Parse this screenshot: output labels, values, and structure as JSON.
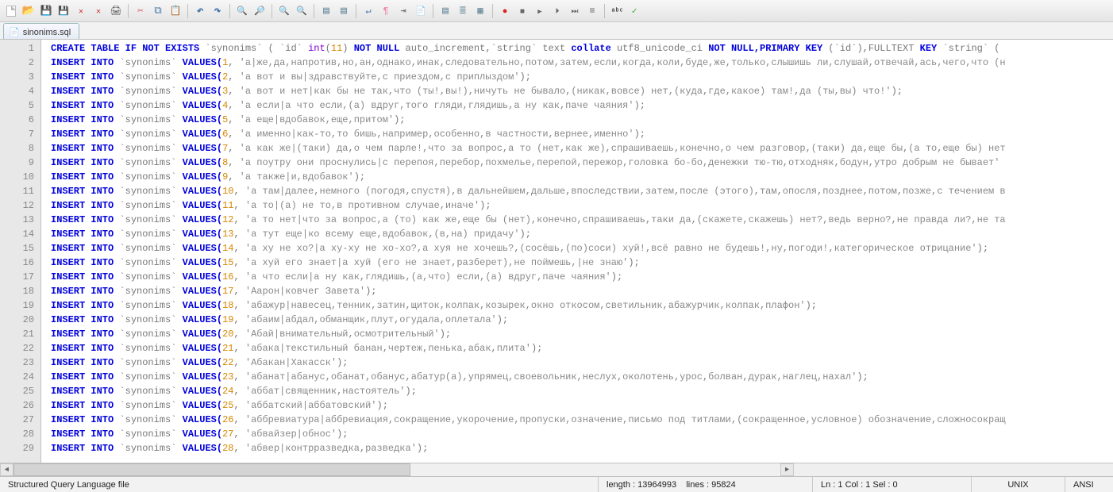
{
  "tab": {
    "name": "sinonims.sql"
  },
  "status": {
    "filetype": "Structured Query Language file",
    "length_label": "length : 13964993",
    "lines_label": "lines : 95824",
    "pos": "Ln : 1    Col : 1    Sel : 0",
    "eol": "UNIX",
    "encoding": "ANSI"
  },
  "editor": {
    "lines": [
      {
        "n": 1,
        "prefix": "CREATE TABLE IF NOT EXISTS",
        "t": " `synonims` ",
        "rest": "( `id` ",
        "type": "int",
        "paren": "(",
        "num": "11",
        "paren2": ")",
        "rest2": " NOT NULL auto_increment,`string` text ",
        "collate": "collate",
        "rest3": " utf8_unicode_ci ",
        "nn": "NOT NULL,PRIMARY KEY",
        "rest4": "  (`id`),FULLTEXT ",
        "key": "KEY",
        "rest5": " `string` ("
      },
      {
        "n": 2,
        "ins": "INSERT INTO",
        "t": " `synonims` ",
        "v": "VALUES(",
        "num": "1",
        "c": ",",
        "s": "'а|же,да,напротив,но,ан,однако,инак,следовательно,потом,затем,если,когда,коли,буде,же,только,слышишь ли,слушай,отвечай,ась,чего,что (н"
      },
      {
        "n": 3,
        "ins": "INSERT INTO",
        "t": " `synonims` ",
        "v": "VALUES(",
        "num": "2",
        "c": ",",
        "s": "'а вот и вы|здравствуйте,с приездом,с приплыздом'",
        "end": ");"
      },
      {
        "n": 4,
        "ins": "INSERT INTO",
        "t": " `synonims` ",
        "v": "VALUES(",
        "num": "3",
        "c": ",",
        "s": "'а вот и нет|как бы не так,что (ты!,вы!),ничуть не бывало,(никак,вовсе) нет,(куда,где,какое) там!,да (ты,вы) что!'",
        "end": ");"
      },
      {
        "n": 5,
        "ins": "INSERT INTO",
        "t": " `synonims` ",
        "v": "VALUES(",
        "num": "4",
        "c": ",",
        "s": "'а если|а что если,(а) вдруг,того гляди,глядишь,а ну как,паче чаяния'",
        "end": ");"
      },
      {
        "n": 6,
        "ins": "INSERT INTO",
        "t": " `synonims` ",
        "v": "VALUES(",
        "num": "5",
        "c": ",",
        "s": "'а еще|вдобавок,еще,притом'",
        "end": ");"
      },
      {
        "n": 7,
        "ins": "INSERT INTO",
        "t": " `synonims` ",
        "v": "VALUES(",
        "num": "6",
        "c": ",",
        "s": "'а именно|как-то,то бишь,например,особенно,в частности,вернее,именно'",
        "end": ");"
      },
      {
        "n": 8,
        "ins": "INSERT INTO",
        "t": " `synonims` ",
        "v": "VALUES(",
        "num": "7",
        "c": ",",
        "s": "'а как же|(таки) да,о чем парле!,что за вопрос,а то (нет,как же),спрашиваешь,конечно,о чем разговор,(таки) да,еще бы,(а то,еще бы) нет"
      },
      {
        "n": 9,
        "ins": "INSERT INTO",
        "t": " `synonims` ",
        "v": "VALUES(",
        "num": "8",
        "c": ",",
        "s": "'а поутру они проснулись|с перепоя,перебор,похмелье,перепой,пережор,головка бо-бо,денежки тю-тю,отходняк,бодун,утро добрым не бывает'"
      },
      {
        "n": 10,
        "ins": "INSERT INTO",
        "t": " `synonims` ",
        "v": "VALUES(",
        "num": "9",
        "c": ",",
        "s": "'а также|и,вдобавок'",
        "end": ");"
      },
      {
        "n": 11,
        "ins": "INSERT INTO",
        "t": " `synonims` ",
        "v": "VALUES(",
        "num": "10",
        "c": ",",
        "s": "'а там|далее,немного (погодя,спустя),в дальнейшем,дальше,впоследствии,затем,после (этого),там,опосля,позднее,потом,позже,с течением в"
      },
      {
        "n": 12,
        "ins": "INSERT INTO",
        "t": " `synonims` ",
        "v": "VALUES(",
        "num": "11",
        "c": ",",
        "s": "'а то|(а) не то,в противном случае,иначе'",
        "end": ");"
      },
      {
        "n": 13,
        "ins": "INSERT INTO",
        "t": " `synonims` ",
        "v": "VALUES(",
        "num": "12",
        "c": ",",
        "s": "'а то нет|что за вопрос,а (то) как же,еще бы (нет),конечно,спрашиваешь,таки да,(скажете,скажешь) нет?,ведь верно?,не правда ли?,не та"
      },
      {
        "n": 14,
        "ins": "INSERT INTO",
        "t": " `synonims` ",
        "v": "VALUES(",
        "num": "13",
        "c": ",",
        "s": "'а тут еще|ко всему еще,вдобавок,(в,на) придачу'",
        "end": ");"
      },
      {
        "n": 15,
        "ins": "INSERT INTO",
        "t": " `synonims` ",
        "v": "VALUES(",
        "num": "14",
        "c": ",",
        "s": "'а ху не хо?|а ху-ху не хо-хо?,а хуя не хочешь?,(сосёшь,(по)соси) хуй!,всё равно не будешь!,ну,погоди!,категорическое отрицание'",
        "end": ");"
      },
      {
        "n": 16,
        "ins": "INSERT INTO",
        "t": " `synonims` ",
        "v": "VALUES(",
        "num": "15",
        "c": ",",
        "s": "'а хуй его знает|а хуй (его не знает,разберет),не поймешь,|не знаю'",
        "end": ");"
      },
      {
        "n": 17,
        "ins": "INSERT INTO",
        "t": " `synonims` ",
        "v": "VALUES(",
        "num": "16",
        "c": ",",
        "s": "'а что если|а ну как,глядишь,(а,что) если,(а) вдруг,паче чаяния'",
        "end": ");"
      },
      {
        "n": 18,
        "ins": "INSERT INTO",
        "t": " `synonims` ",
        "v": "VALUES(",
        "num": "17",
        "c": ",",
        "s": "'Аарон|ковчег Завета'",
        "end": ");"
      },
      {
        "n": 19,
        "ins": "INSERT INTO",
        "t": " `synonims` ",
        "v": "VALUES(",
        "num": "18",
        "c": ",",
        "s": "'абажур|навесец,тенник,затин,щиток,колпак,козырек,окно откосом,светильник,абажурчик,колпак,плафон'",
        "end": ");"
      },
      {
        "n": 20,
        "ins": "INSERT INTO",
        "t": " `synonims` ",
        "v": "VALUES(",
        "num": "19",
        "c": ",",
        "s": "'абаим|абдал,обманщик,плут,огудала,оплетала'",
        "end": ");"
      },
      {
        "n": 21,
        "ins": "INSERT INTO",
        "t": " `synonims` ",
        "v": "VALUES(",
        "num": "20",
        "c": ",",
        "s": "'Абай|внимательный,осмотрительный'",
        "end": ");"
      },
      {
        "n": 22,
        "ins": "INSERT INTO",
        "t": " `synonims` ",
        "v": "VALUES(",
        "num": "21",
        "c": ",",
        "s": "'абака|текстильный банан,чертеж,пенька,абак,плита'",
        "end": ");"
      },
      {
        "n": 23,
        "ins": "INSERT INTO",
        "t": " `synonims` ",
        "v": "VALUES(",
        "num": "22",
        "c": ",",
        "s": "'Абакан|Хакасск'",
        "end": ");"
      },
      {
        "n": 24,
        "ins": "INSERT INTO",
        "t": " `synonims` ",
        "v": "VALUES(",
        "num": "23",
        "c": ",",
        "s": "'абанат|абанус,обанат,обанус,абатур(а),упрямец,своевольник,неслух,околотень,урос,болван,дурак,наглец,нахал'",
        "end": ");"
      },
      {
        "n": 25,
        "ins": "INSERT INTO",
        "t": " `synonims` ",
        "v": "VALUES(",
        "num": "24",
        "c": ",",
        "s": "'аббат|священник,настоятель'",
        "end": ");"
      },
      {
        "n": 26,
        "ins": "INSERT INTO",
        "t": " `synonims` ",
        "v": "VALUES(",
        "num": "25",
        "c": ",",
        "s": "'аббатский|аббатовский'",
        "end": ");"
      },
      {
        "n": 27,
        "ins": "INSERT INTO",
        "t": " `synonims` ",
        "v": "VALUES(",
        "num": "26",
        "c": ",",
        "s": "'аббревиатура|аббревиация,сокращение,укорочение,пропуски,означение,письмо под титлами,(сокращенное,условное) обозначение,сложносокращ"
      },
      {
        "n": 28,
        "ins": "INSERT INTO",
        "t": " `synonims` ",
        "v": "VALUES(",
        "num": "27",
        "c": ",",
        "s": "'абвайзер|обнос'",
        "end": ");"
      },
      {
        "n": 29,
        "ins": "INSERT INTO",
        "t": " `synonims` ",
        "v": "VALUES(",
        "num": "28",
        "c": ",",
        "s": "'абвер|контрразведка,разведка'",
        "end": ");"
      }
    ]
  }
}
